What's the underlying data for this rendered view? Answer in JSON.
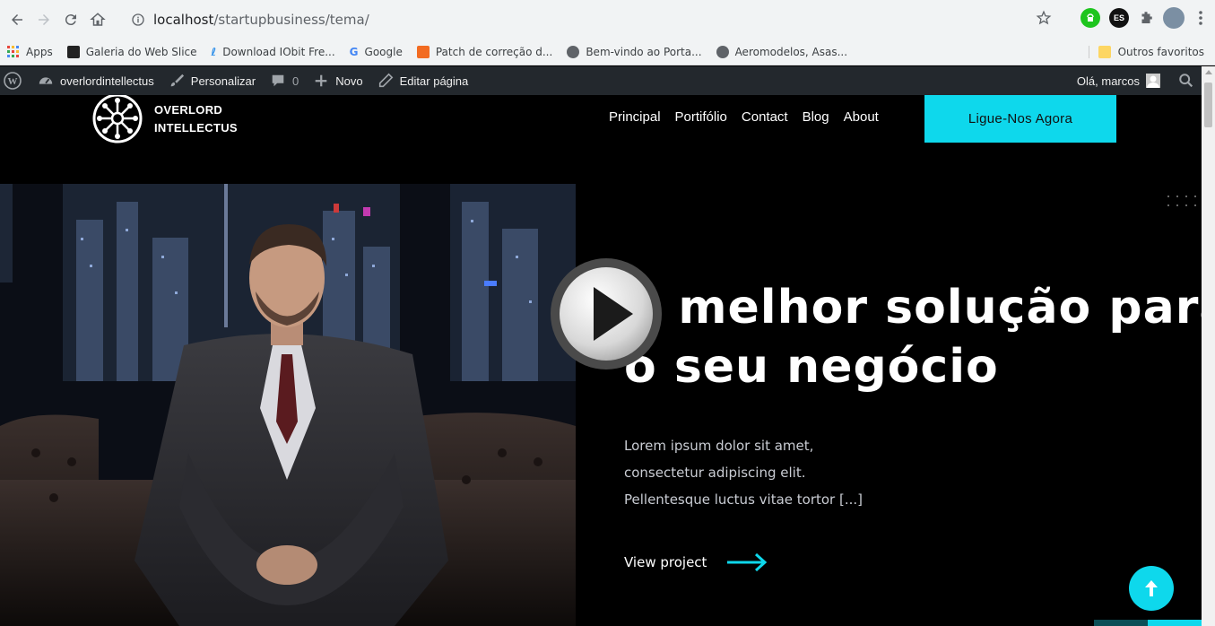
{
  "browser": {
    "url_host": "localhost",
    "url_path": "/startupbusiness/tema/",
    "extensions": [
      {
        "name": "green-extension-icon",
        "color": "#1ec51e",
        "label": ""
      },
      {
        "name": "es-extension-icon",
        "color": "#111111",
        "label": "ES"
      }
    ]
  },
  "bookmarks": {
    "items": [
      {
        "label": "Apps",
        "icon": "apps-grid-icon",
        "color": "#e8453c"
      },
      {
        "label": "Galeria do Web Slice",
        "icon": "web-slice-icon",
        "color": "#222222"
      },
      {
        "label": "Download IObit Fre...",
        "icon": "iobit-icon",
        "color": "#2a8de9"
      },
      {
        "label": "Google",
        "icon": "google-icon",
        "color": "#4285f4"
      },
      {
        "label": "Patch de correção d...",
        "icon": "patch-icon",
        "color": "#f26b21"
      },
      {
        "label": "Bem-vindo ao Porta...",
        "icon": "globe-icon",
        "color": "#5f6368"
      },
      {
        "label": "Aeromodelos, Asas...",
        "icon": "globe-icon",
        "color": "#5f6368"
      }
    ],
    "other": "Outros favoritos"
  },
  "adminbar": {
    "site_name": "overlordintellectus",
    "customize": "Personalizar",
    "comments_count": "0",
    "new": "Novo",
    "edit_page": "Editar página",
    "greeting": "Olá, marcos"
  },
  "site": {
    "logo_line1": "OVERLORD",
    "logo_line2": "INTELLECTUS",
    "menu": [
      "Principal",
      "Portifólio",
      "Contact",
      "Blog",
      "About"
    ],
    "cta": "Ligue-Nos Agora",
    "accent": "#0ed8ec"
  },
  "hero": {
    "title_line1": "A melhor solução para",
    "title_line2": "o seu negócio",
    "text_line1": "Lorem ipsum dolor sit amet,",
    "text_line2": "consectetur adipiscing elit.",
    "text_line3": "Pellentesque luctus vitae tortor [...]",
    "view_project": "View project"
  }
}
